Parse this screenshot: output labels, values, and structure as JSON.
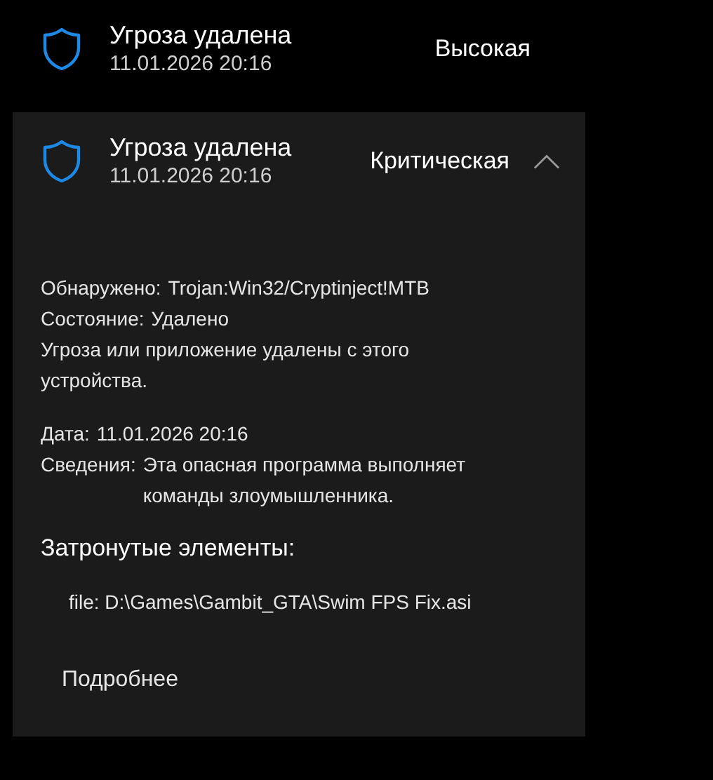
{
  "threats": [
    {
      "title": "Угроза удалена",
      "date": "11.01.2026 20:16",
      "severity": "Высокая",
      "expanded": false
    },
    {
      "title": "Угроза удалена",
      "date": "11.01.2026 20:16",
      "severity": "Критическая",
      "expanded": true,
      "details": {
        "detected_label": "Обнаружено:",
        "detected": "Trojan:Win32/Cryptinject!MTB",
        "status_label": "Состояние:",
        "status": "Удалено",
        "status_note": "Угроза или приложение удалены с этого устройства.",
        "date_label": "Дата:",
        "date": "11.01.2026 20:16",
        "info_label": "Сведения:",
        "info": "Эта опасная программа выполняет команды злоумышленника.",
        "affected_heading": "Затронутые элементы:",
        "affected_items": [
          "file: D:\\Games\\Gambit_GTA\\Swim FPS Fix.asi"
        ],
        "more_link": "Подробнее"
      }
    }
  ]
}
